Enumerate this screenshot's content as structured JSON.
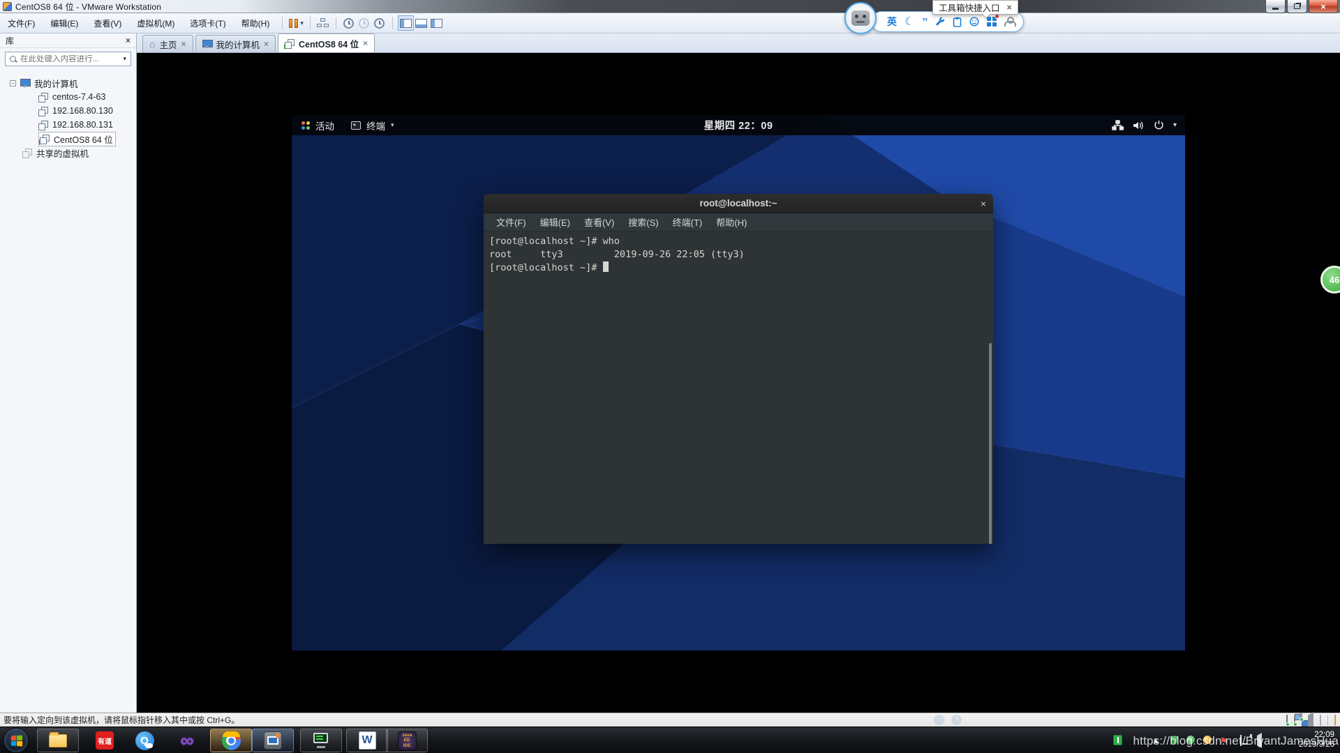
{
  "window": {
    "title": "CentOS8 64 位 - VMware Workstation",
    "menu": [
      "文件(F)",
      "编辑(E)",
      "查看(V)",
      "虚拟机(M)",
      "选项卡(T)",
      "帮助(H)"
    ]
  },
  "icons": {
    "close": "×",
    "caret": "▾",
    "minus": "−",
    "home": "⌂",
    "moon": "☾",
    "quotes": "’’",
    "infinity": "∞",
    "flag": "⚑",
    "tray_arrow": "▲",
    "word": "W",
    "qq": "Q",
    "question": "?"
  },
  "tabs": {
    "home": "主页",
    "computer": "我的计算机",
    "vm": "CentOS8 64 位"
  },
  "sidebar": {
    "title": "库",
    "search_placeholder": "在此处键入内容进行...",
    "items": [
      {
        "label": "我的计算机"
      },
      {
        "label": "centos-7.4-63"
      },
      {
        "label": "192.168.80.130"
      },
      {
        "label": "192.168.80.131"
      },
      {
        "label": "CentOS8 64 位"
      },
      {
        "label": "共享的虚拟机"
      }
    ]
  },
  "guest": {
    "activities": "活动",
    "app_menu": "终端",
    "clock": "星期四 22：09",
    "terminal": {
      "title": "root@localhost:~",
      "menu": [
        "文件(F)",
        "编辑(E)",
        "查看(V)",
        "搜索(S)",
        "终端(T)",
        "帮助(H)"
      ],
      "line1": "[root@localhost ~]# who",
      "line2": "root     tty3         2019-09-26 22:05 (tty3)",
      "line3": "[root@localhost ~]# "
    }
  },
  "statusbar": {
    "hint": "要将输入定向到该虚拟机，请将鼠标指针移入其中或按 Ctrl+G。"
  },
  "ime": {
    "tooltip": "工具箱快捷入口",
    "lang": "英"
  },
  "taskbar": {
    "youdao": "有道",
    "ide_label": "Java EE IDE",
    "time": "22:09",
    "date": "2019/9/26",
    "watermark": "https://blog.csdn.net/BryantJamesHua"
  },
  "edge_badge": "46"
}
